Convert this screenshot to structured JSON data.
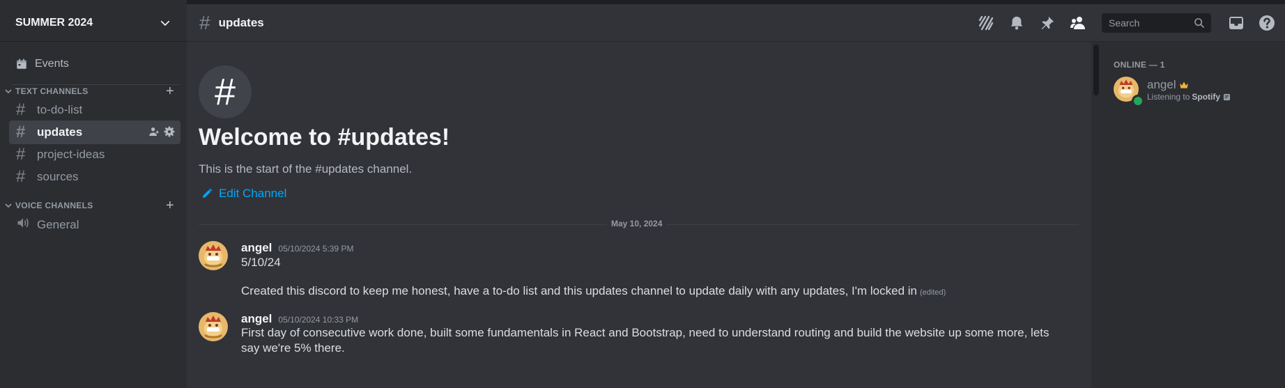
{
  "server": {
    "name": "SUMMER 2024"
  },
  "sidebar": {
    "events_label": "Events",
    "categories": [
      {
        "label": "TEXT CHANNELS",
        "add": "+"
      },
      {
        "label": "VOICE CHANNELS",
        "add": "+"
      }
    ],
    "text_channels": [
      {
        "name": "to-do-list"
      },
      {
        "name": "updates",
        "active": true
      },
      {
        "name": "project-ideas"
      },
      {
        "name": "sources"
      }
    ],
    "voice_channels": [
      {
        "name": "General"
      }
    ]
  },
  "header": {
    "channel": "updates",
    "search_placeholder": "Search",
    "icons": [
      "threads-icon",
      "bell-icon",
      "pin-icon",
      "members-icon",
      "search-icon",
      "inbox-icon",
      "help-icon"
    ]
  },
  "chat": {
    "hash_glyph": "#",
    "welcome_title": "Welcome to #updates!",
    "welcome_sub": "This is the start of the #updates channel.",
    "edit_label": "Edit Channel",
    "date_divider": "May 10, 2024",
    "messages": [
      {
        "author": "angel",
        "time": "05/10/2024 5:39 PM",
        "lines": [
          "5/10/24",
          "",
          "Created this discord to keep me honest, have a to-do list and this updates channel to update daily with any updates, I'm locked in"
        ],
        "edited": "(edited)"
      },
      {
        "author": "angel",
        "time": "05/10/2024 10:33 PM",
        "lines": [
          "First day of consecutive work done, built some fundamentals in React and Bootstrap, need to understand routing and build the website up some more, lets",
          "say we're 5% there."
        ]
      }
    ]
  },
  "members": {
    "online_header": "ONLINE — 1",
    "list": [
      {
        "name": "angel",
        "activity_prefix": "Listening to",
        "activity_app": "Spotify",
        "status_color": "#23a55a",
        "badge": "crown-icon"
      }
    ]
  },
  "colors": {
    "accent_link": "#00a8fc",
    "online": "#23a55a",
    "bg_chat": "#313338",
    "bg_sidebar": "#2b2d31"
  }
}
